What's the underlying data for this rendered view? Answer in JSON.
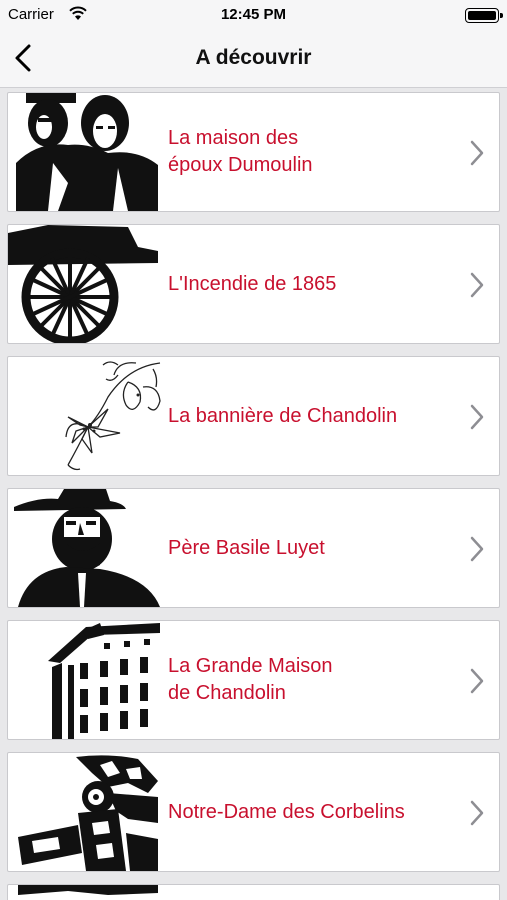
{
  "status_bar": {
    "carrier": "Carrier",
    "time": "12:45 PM"
  },
  "nav": {
    "title": "A découvrir"
  },
  "colors": {
    "accent": "#c8102e",
    "chevron": "#8e8e93"
  },
  "items": [
    {
      "label": "La maison des\népoux Dumoulin",
      "icon": "couple-portrait-icon"
    },
    {
      "label": "L'Incendie de 1865",
      "icon": "cart-wheel-icon"
    },
    {
      "label": "La bannière de Chandolin",
      "icon": "lily-flower-icon"
    },
    {
      "label": "Père Basile Luyet",
      "icon": "man-with-hat-portrait-icon"
    },
    {
      "label": "La Grande Maison\nde Chandolin",
      "icon": "building-icon"
    },
    {
      "label": "Notre-Dame des Corbelins",
      "icon": "statue-icon"
    }
  ]
}
